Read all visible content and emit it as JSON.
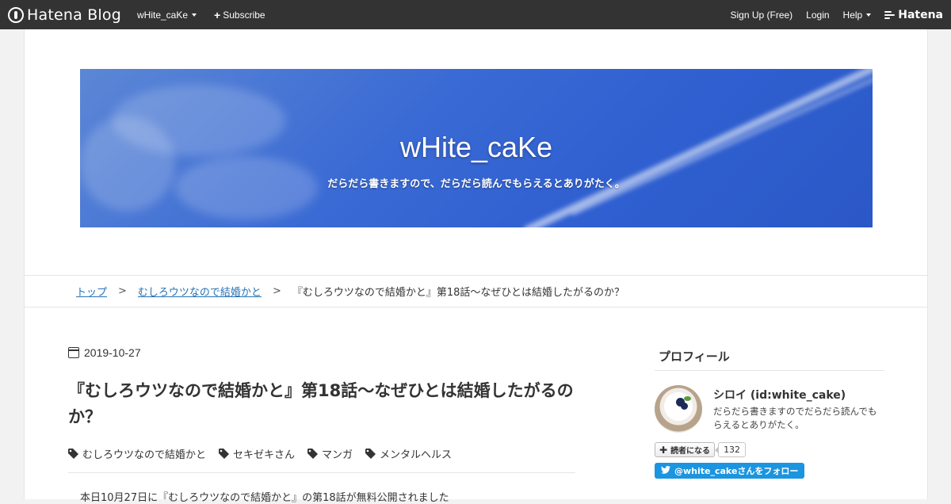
{
  "topbar": {
    "brand": "Hatena Blog",
    "blog_menu": "wHite_caKe",
    "subscribe": "Subscribe",
    "signup": "Sign Up (Free)",
    "login": "Login",
    "help": "Help",
    "hatena": "Hatena"
  },
  "header": {
    "title": "wHite_caKe",
    "description": "だらだら書きますので、だらだら読んでもらえるとありがたく。"
  },
  "breadcrumb": {
    "top": "トップ",
    "category": "むしろウツなので結婚かと",
    "current": "『むしろウツなので結婚かと』第18話～なぜひとは結婚したがるのか？"
  },
  "entry": {
    "date": "2019-10-27",
    "title": "『むしろウツなので結婚かと』第18話～なぜひとは結婚したがるのか？",
    "tags": [
      "むしろウツなので結婚かと",
      "セキゼキさん",
      "マンガ",
      "メンタルヘルス"
    ],
    "body_start": "本日10月27日に『むしろウツなので結婚かと』の第18話が無料公開されました"
  },
  "sidebar": {
    "heading": "プロフィール",
    "profile_name": "シロイ (id:white_cake)",
    "profile_desc": "だらだら書きますのでだらだら読んでもらえるとありがたく。",
    "reader_button": "読者になる",
    "reader_count": "132",
    "twitter_follow": "@white_cakeさんをフォロー"
  },
  "colors": {
    "topbar": "#333333",
    "link": "#2672b5",
    "twitter": "#1b95e0",
    "banner": "#3a6ad4"
  }
}
